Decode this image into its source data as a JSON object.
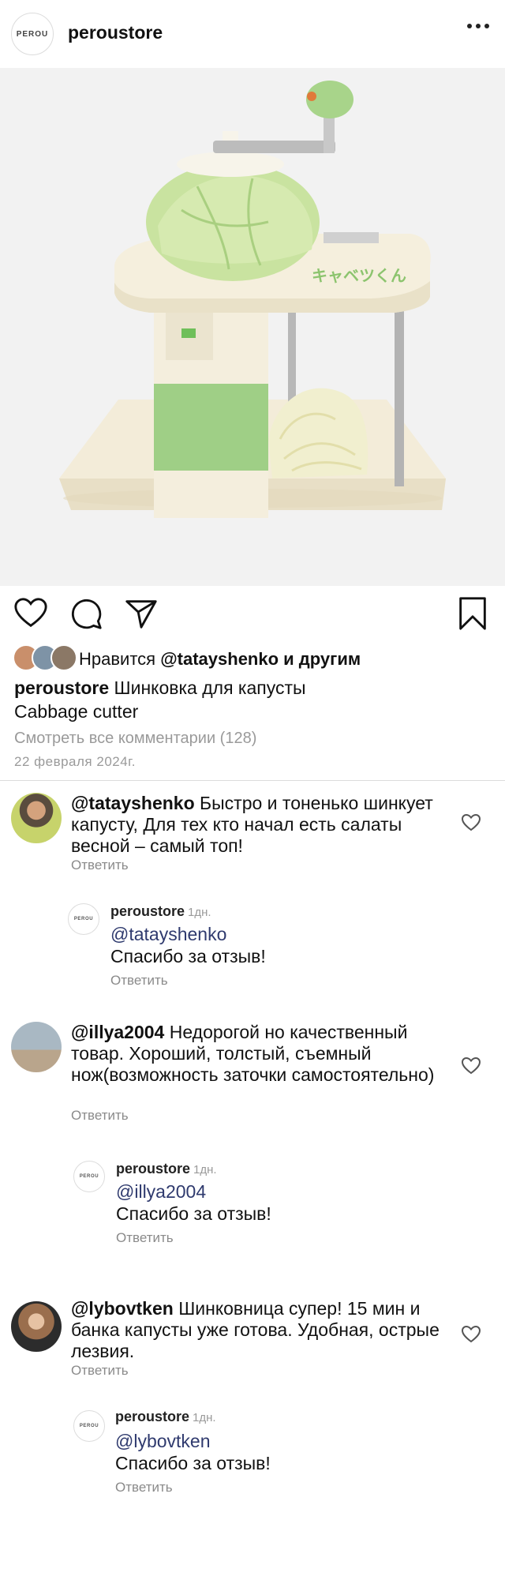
{
  "header": {
    "logo_text": "PEROU",
    "username": "peroustore",
    "more_icon": "more-horizontal-icon"
  },
  "post": {
    "image_alt": "Cabbage cutter with crank handle, cabbage on top and shredded cabbage below",
    "likes_prefix": "Нравится",
    "likes_user": "@tatayshenko",
    "likes_suffix": "и другим",
    "caption_user": "peroustore",
    "caption_text": "Шинковка для капусты",
    "caption_line2": "Cabbage cutter",
    "view_all_comments": "Смотреть все комментарии (128)",
    "date": "22 февраля 2024г."
  },
  "comments": [
    {
      "user": "@tatayshenko",
      "text": "Быстро и тоненько шинкует капусту, Для тех кто начал есть салаты весной – самый топ!",
      "reply_label": "Ответить",
      "reply": {
        "logo_text": "PEROU",
        "user": "peroustore",
        "time": "1дн.",
        "mention": "@tatayshenko",
        "text": "Спасибо за отзыв!",
        "reply_label": "Ответить"
      }
    },
    {
      "user": "@illya2004",
      "text": "Недорогой но качественный товар. Хороший, толстый, съемный нож(возможность заточки самостоятельно)",
      "reply_label": "Ответить",
      "reply": {
        "logo_text": "PEROU",
        "user": "peroustore",
        "time": "1дн.",
        "mention": "@illya2004",
        "text": "Спасибо за отзыв!",
        "reply_label": "Ответить"
      }
    },
    {
      "user": "@lybovtken",
      "text": "Шинковница супер! 15 мин и банка капусты уже готова. Удобная, острые лезвия.",
      "reply_label": "Ответить",
      "reply": {
        "logo_text": "PEROU",
        "user": "peroustore",
        "time": "1дн.",
        "mention": "@lybovtken",
        "text": "Спасибо за отзыв!",
        "reply_label": "Ответить"
      }
    }
  ]
}
